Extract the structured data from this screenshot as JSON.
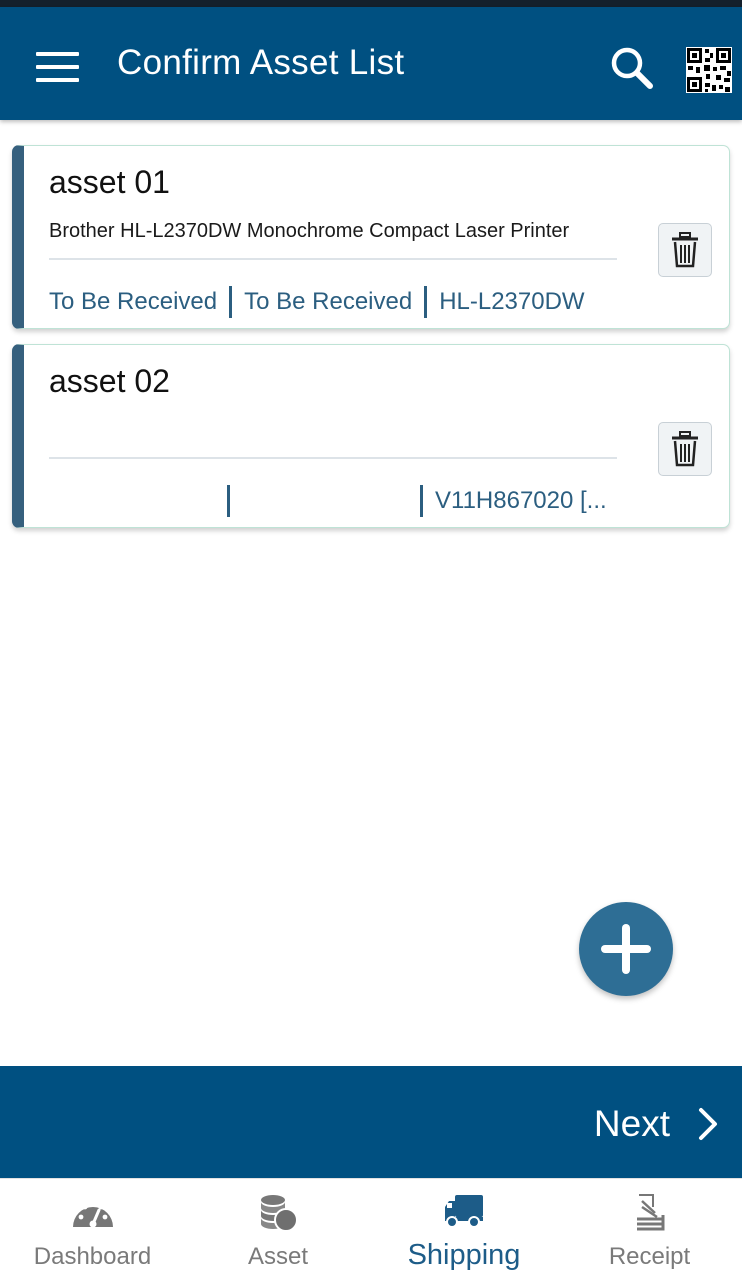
{
  "header": {
    "title": "Confirm Asset List",
    "menu_icon": "hamburger-menu-icon",
    "search_icon": "search-icon",
    "qr_icon": "qr-code-icon",
    "color": "#005081"
  },
  "assets": [
    {
      "name": "asset 01",
      "description": "Brother HL-L2370DW Monochrome Compact Laser Printer",
      "status_1": "To Be Received",
      "status_2": "To Be Received",
      "model": "HL-L2370DW"
    },
    {
      "name": "asset 02",
      "description": "",
      "status_1": "",
      "status_2": "",
      "model": "V11H867020 [..."
    }
  ],
  "fab": {
    "icon": "plus-icon",
    "color": "#2e6e95"
  },
  "footer": {
    "next_label": "Next",
    "next_icon": "chevron-right-icon"
  },
  "bottom_nav": [
    {
      "label": "Dashboard",
      "icon": "speedometer-icon",
      "active": false
    },
    {
      "label": "Asset",
      "icon": "coins-icon",
      "active": false
    },
    {
      "label": "Shipping",
      "icon": "truck-icon",
      "active": true
    },
    {
      "label": "Receipt",
      "icon": "receipt-icon",
      "active": false
    }
  ],
  "colors": {
    "accent": "#005081",
    "card_accent": "#36607e",
    "meta_text": "#2b5e80",
    "active_nav": "#1d5c88"
  }
}
